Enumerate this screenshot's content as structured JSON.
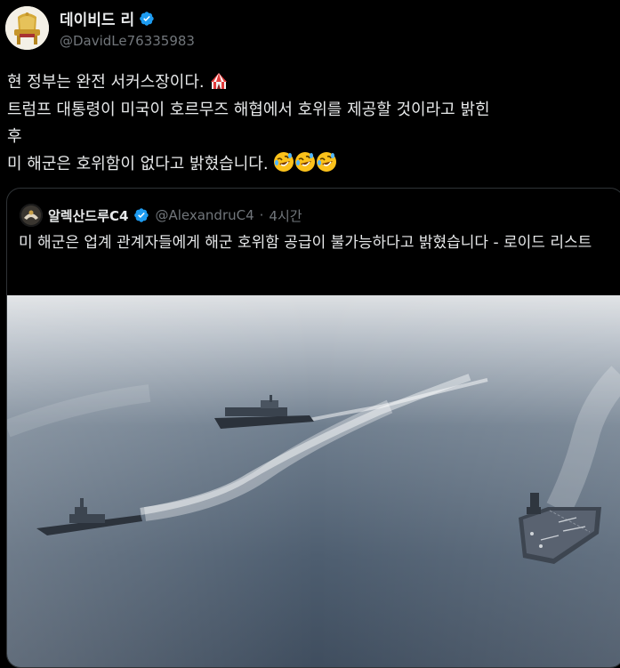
{
  "author": {
    "display_name": "데이비드 리",
    "handle": "@DavidLe76335983"
  },
  "tweet": {
    "lines": [
      "현 정부는 완전 서커스장이다. ",
      "트럼프 대통령이 미국이 호르무즈 해협에서 호위를 제공할 것이라고 밝힌",
      "후",
      "미 해군은 호위함이 없다고 밝혔습니다. "
    ],
    "emoji": [
      "circus-tent",
      "rolling-on-floor-laughing",
      "rolling-on-floor-laughing",
      "rolling-on-floor-laughing"
    ]
  },
  "quoted": {
    "display_name": "알렉산드루C4",
    "handle": "@AlexandruC4",
    "separator": "·",
    "time": "4시간",
    "text": "미 해군은 업계 관계자들에게 해군 호위함 공급이 불가능하다고 밝혔습니다 - 로이드 리스트",
    "image": {
      "subject": "naval-ships-at-sea",
      "colors": {
        "sea": "#4a5a6c",
        "sky": "#d9dde1"
      }
    }
  },
  "colors": {
    "background": "#000000",
    "text": "#e7e9ea",
    "muted": "#71767b",
    "verified": "#1d9bf0",
    "border": "#2f3336"
  }
}
